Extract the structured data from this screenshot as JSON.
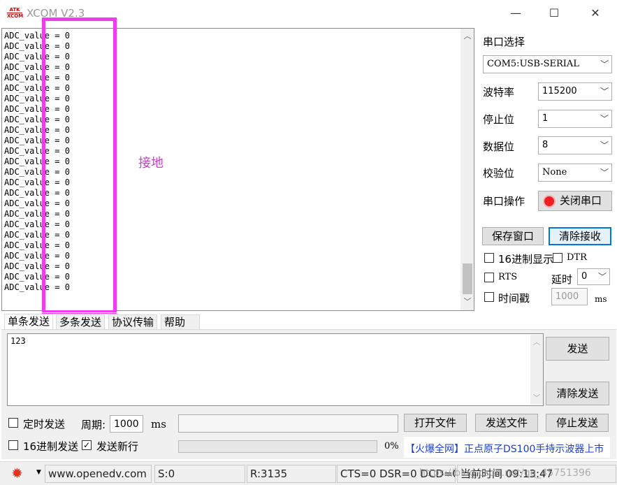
{
  "window": {
    "title": "XCOM V2.3",
    "logo_text": "ATK XCOM",
    "minimize": "—",
    "maximize": "☐",
    "close": "✕"
  },
  "receive": {
    "lines": [
      "ADC_value = 0",
      "ADC_value = 0",
      "ADC_value = 0",
      "ADC_value = 0",
      "ADC_value = 0",
      "ADC_value = 0",
      "ADC_value = 0",
      "ADC_value = 0",
      "ADC_value = 0",
      "ADC_value = 0",
      "ADC_value = 0",
      "ADC_value = 0",
      "ADC_value = 0",
      "ADC_value = 0",
      "ADC_value = 0",
      "ADC_value = 0",
      "ADC_value = 0",
      "ADC_value = 0",
      "ADC_value = 0",
      "ADC_value = 0",
      "ADC_value = 0",
      "ADC_value = 0",
      "ADC_value = 0",
      "ADC_value = 0",
      "ADC_value = 0"
    ],
    "annotation": "接地"
  },
  "settings": {
    "section_title": "串口选择",
    "port_value": "COM5:USB-SERIAL",
    "baud_label": "波特率",
    "baud_value": "115200",
    "stop_label": "停止位",
    "stop_value": "1",
    "data_label": "数据位",
    "data_value": "8",
    "parity_label": "校验位",
    "parity_value": "None",
    "op_label": "串口操作",
    "op_button": "关闭串口",
    "save_window": "保存窗口",
    "clear_receive": "清除接收",
    "hex_display": "16进制显示",
    "dtr": "DTR",
    "rts": "RTS",
    "delay_label": "延时",
    "delay_value": "0",
    "timestamp": "时间戳",
    "timestamp_value": "1000",
    "timestamp_unit": "ms",
    "accent": "#0078d7"
  },
  "tabs": [
    "单条发送",
    "多条发送",
    "协议传输",
    "帮助"
  ],
  "send": {
    "text": "123",
    "send_button": "发送",
    "clear_send": "清除发送",
    "timed_send": "定时发送",
    "period_label": "周期:",
    "period_value": "1000",
    "period_unit": "ms",
    "open_file": "打开文件",
    "send_file": "发送文件",
    "stop_send": "停止发送",
    "hex_send": "16进制发送",
    "newline": "发送新行",
    "newline_checked": true,
    "progress": "0%",
    "ad": "【火爆全网】正点原子DS100手持示波器上市"
  },
  "status": {
    "website": "www.openedv.com",
    "s": "S:0",
    "r": "R:3135",
    "lines": "CTS=0 DSR=0 DCD=0",
    "time": "当前时间 09:13:47",
    "watermark": "https://blog.csdn.net/qq_45751396"
  }
}
